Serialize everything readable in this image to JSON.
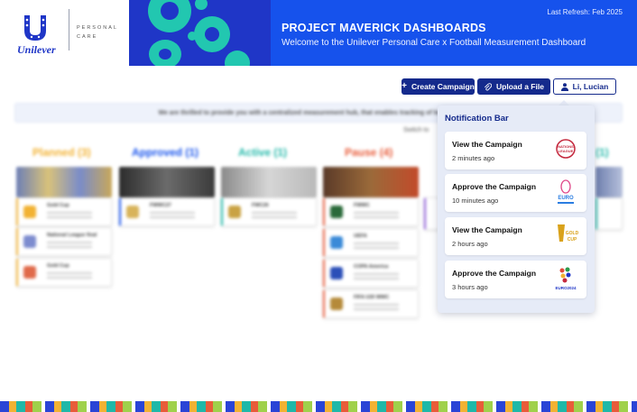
{
  "brand": {
    "logo_word": "Unilever",
    "division": "PERSONAL CARE",
    "accent": "#1652ec",
    "navy": "#142a8c"
  },
  "header": {
    "last_refresh": "Last Refresh: Feb 2025",
    "title": "PROJECT MAVERICK DASHBOARDS",
    "subtitle": "Welcome to the Unilever Personal Care x Football Measurement Dashboard"
  },
  "actions": {
    "create_campaign": "Create Campaign",
    "create_icon": "plus-icon",
    "upload_file": "Upload a File",
    "upload_icon": "paperclip-icon",
    "user": "Li, Lucian",
    "user_icon": "user-icon"
  },
  "dashboard": {
    "message": "We are thrilled to provide you with a centralized measurement hub, that enables tracking of key metrics for",
    "switch_text": "Switch to",
    "columns": [
      {
        "label": "Planned (3)",
        "color": "#f2b233"
      },
      {
        "label": "Approved (1)",
        "color": "#1652ec"
      },
      {
        "label": "Active (1)",
        "color": "#1fb8a8"
      },
      {
        "label": "Pause (4)",
        "color": "#e85c3a"
      },
      {
        "label": "(1)",
        "color": "#1fb8a8"
      }
    ],
    "cards": {
      "planned": [
        "Gold Cup",
        "National League final",
        "Gold Cup"
      ],
      "approved": [
        "FWWC27"
      ],
      "active": [
        "FWC26"
      ],
      "pause": [
        "FWWC",
        "UEFA",
        "COPA America",
        "FIFA U20 WWC"
      ]
    }
  },
  "notifications": {
    "title": "Notification Bar",
    "items": [
      {
        "title": "View the Campaign",
        "time": "2 minutes ago",
        "logo_text": "NATIONS LEAGUE",
        "logo_color": "#c4283d"
      },
      {
        "title": "Approve the Campaign",
        "time": "10 minutes ago",
        "logo_text": "EURO",
        "logo_color": "#2a7de1"
      },
      {
        "title": "View the Campaign",
        "time": "2 hours ago",
        "logo_text": "GOLD CUP",
        "logo_color": "#d9a21b"
      },
      {
        "title": "Approve the Campaign",
        "time": "3 hours ago",
        "logo_text": "EURO2024",
        "logo_color": "#1f36c7"
      }
    ]
  }
}
